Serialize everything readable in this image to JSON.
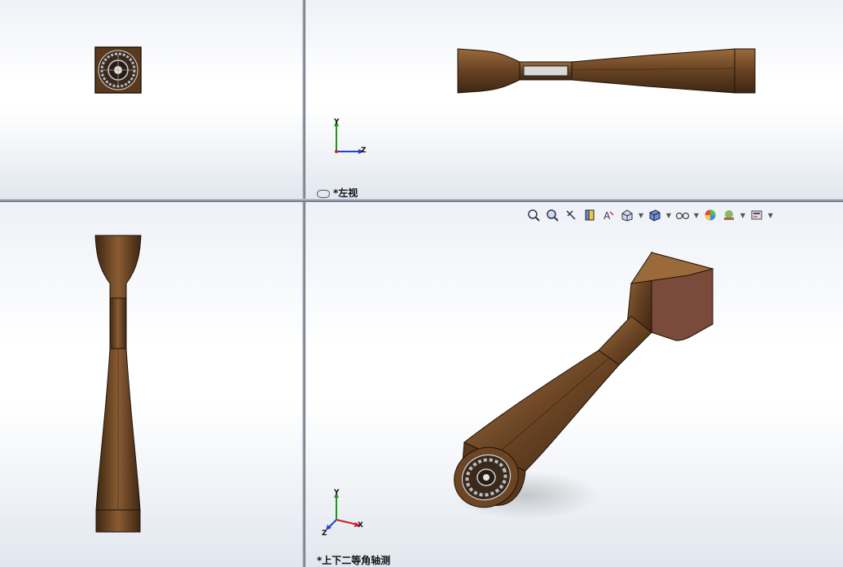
{
  "viewports": {
    "top_left": {
      "label": ""
    },
    "top_right": {
      "label": "*左视"
    },
    "bottom_left": {
      "label": ""
    },
    "bottom_right": {
      "label": "*上下二等角轴测"
    }
  },
  "axes": {
    "x": "X",
    "y": "Y",
    "z": "Z"
  },
  "toolbar": {
    "items": [
      "zoom-to-fit-icon",
      "zoom-to-area-icon",
      "previous-view-icon",
      "section-view-icon",
      "dynamic-annotation-icon",
      "view-orientation-icon",
      "display-style-icon",
      "hide-show-items-icon",
      "edit-appearance-icon",
      "apply-scene-icon",
      "view-settings-icon"
    ]
  },
  "colors": {
    "model": "#6b4524",
    "model_light": "#8a5c33",
    "model_dark": "#3e2612",
    "background": "#ffffff"
  }
}
